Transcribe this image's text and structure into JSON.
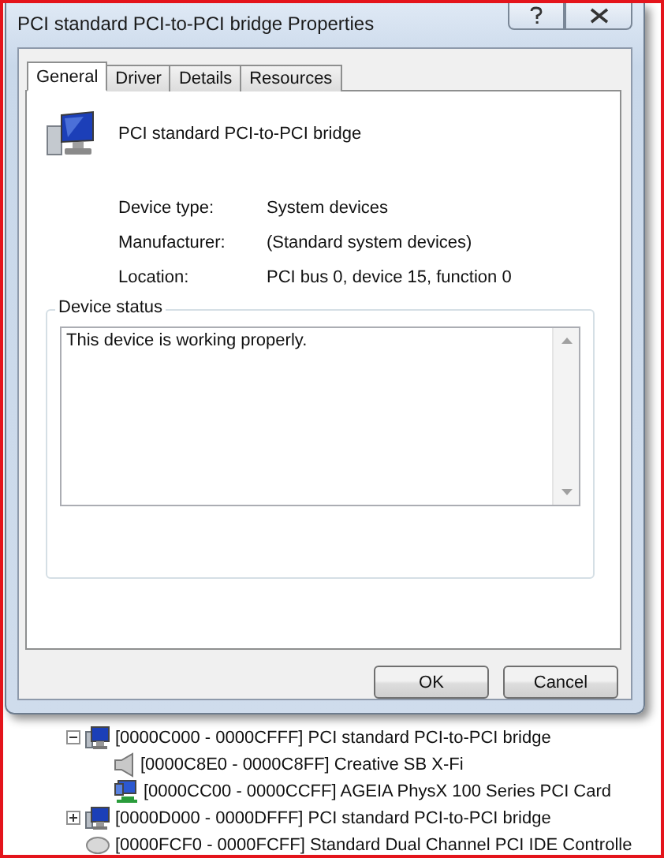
{
  "window": {
    "title": "PCI standard PCI-to-PCI bridge Properties"
  },
  "tabs": [
    {
      "label": "General",
      "selected": true
    },
    {
      "label": "Driver",
      "selected": false
    },
    {
      "label": "Details",
      "selected": false
    },
    {
      "label": "Resources",
      "selected": false
    }
  ],
  "device": {
    "name": "PCI standard PCI-to-PCI bridge"
  },
  "properties": [
    {
      "label": "Device type:",
      "value": "System devices"
    },
    {
      "label": "Manufacturer:",
      "value": "(Standard system devices)"
    },
    {
      "label": "Location:",
      "value": "PCI bus 0, device 15, function 0"
    }
  ],
  "device_status": {
    "title": "Device status",
    "text": "This device is working properly."
  },
  "buttons": [
    "OK",
    "Cancel"
  ],
  "tree": [
    {
      "kind": "bridge",
      "text": "[0000C000 - 0000CFFF]  PCI standard PCI-to-PCI bridge",
      "expanded": true,
      "children": [
        {
          "kind": "speaker",
          "text": "[0000C8E0 - 0000C8FF]  Creative SB X-Fi"
        },
        {
          "kind": "network",
          "text": "[0000CC00 - 0000CCFF]  AGEIA PhysX 100 Series PCI Card"
        }
      ]
    },
    {
      "kind": "bridge",
      "text": "[0000D000 - 0000DFFF]  PCI standard PCI-to-PCI bridge",
      "expanded": false
    },
    {
      "kind": "disk",
      "text": "[0000FCF0 - 0000FCFF]  Standard Dual Channel PCI IDE Controlle"
    }
  ]
}
